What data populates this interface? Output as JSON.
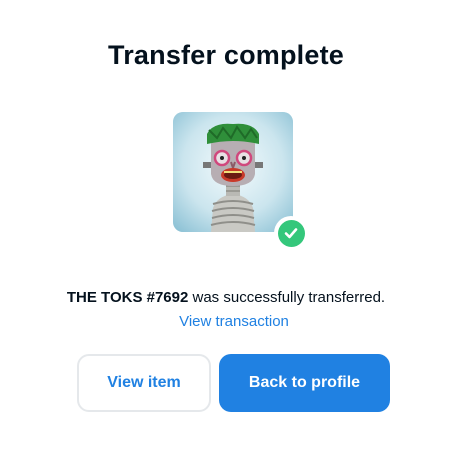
{
  "modal": {
    "title": "Transfer complete"
  },
  "nft": {
    "image_alt": "THE TOKS #7692",
    "status_icon": "check-circle-icon",
    "status_color": "#34c77b"
  },
  "message": {
    "item_name": "THE TOKS #7692",
    "suffix": " was successfully transferred."
  },
  "links": {
    "view_transaction": "View transaction"
  },
  "buttons": {
    "view_item": "View item",
    "back_to_profile": "Back to profile"
  },
  "colors": {
    "accent": "#2081e2",
    "text": "#04111d",
    "success": "#34c77b",
    "border": "#e5e8eb"
  }
}
